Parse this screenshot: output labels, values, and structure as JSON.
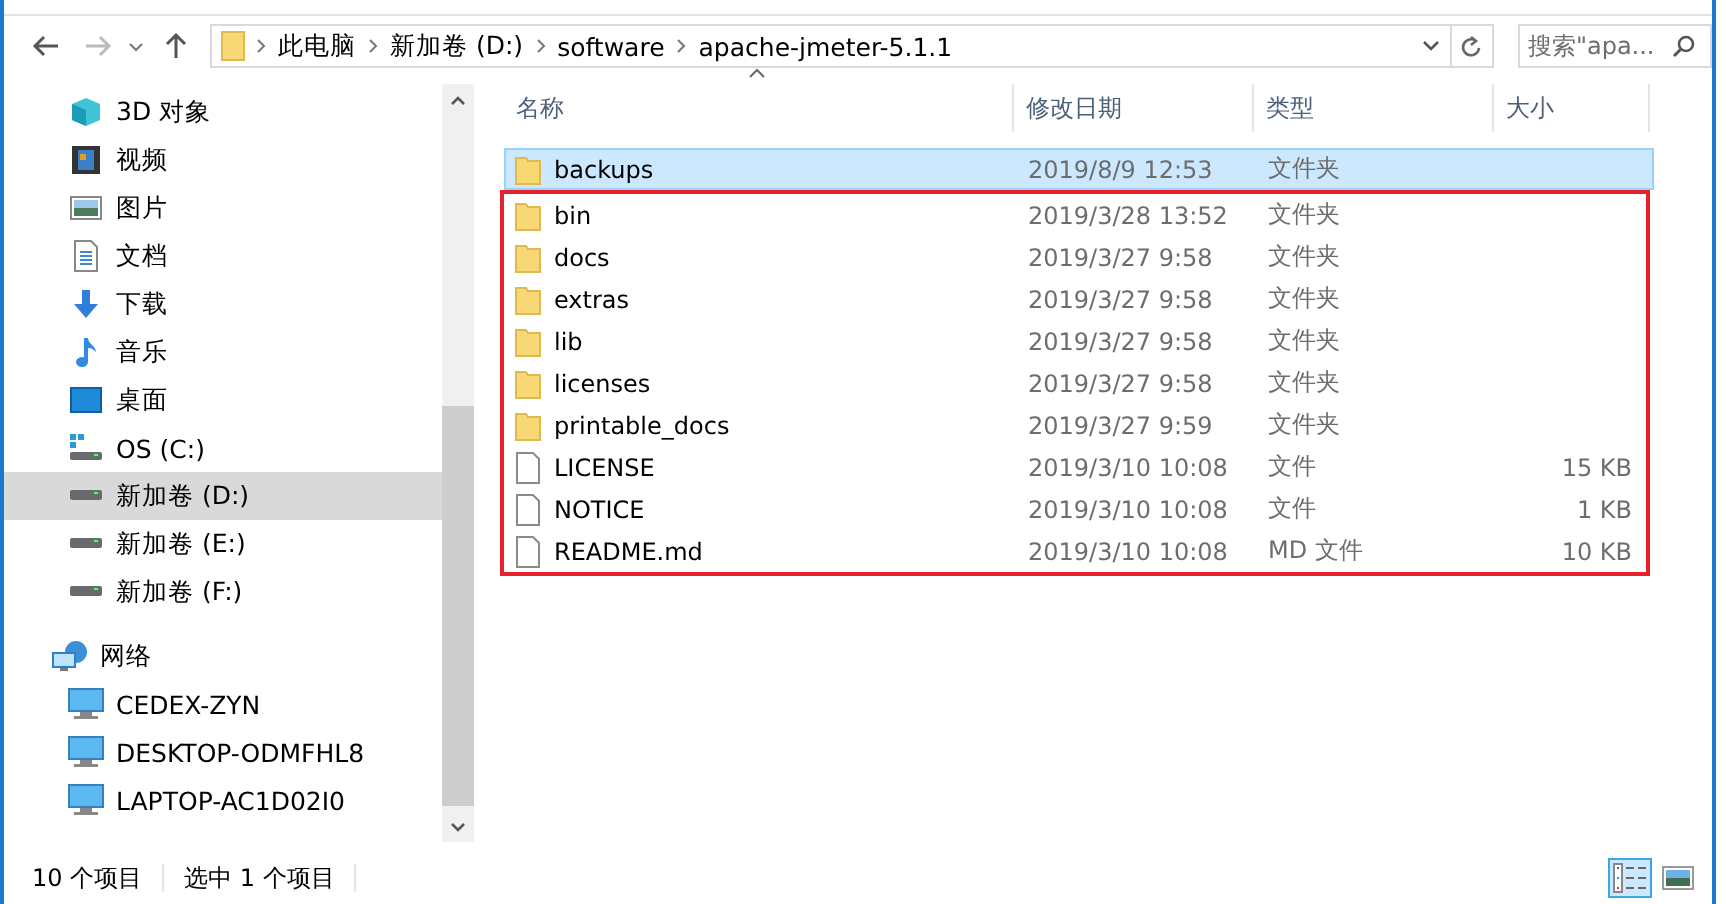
{
  "address_bar": {
    "segments": [
      "此电脑",
      "新加卷 (D:)",
      "software",
      "apache-jmeter-5.1.1"
    ]
  },
  "search": {
    "placeholder": "搜索\"apa..."
  },
  "sidebar": {
    "items": [
      {
        "label": "3D 对象",
        "kind": "objects",
        "selected": false
      },
      {
        "label": "视频",
        "kind": "video",
        "selected": false
      },
      {
        "label": "图片",
        "kind": "pictures",
        "selected": false
      },
      {
        "label": "文档",
        "kind": "documents",
        "selected": false
      },
      {
        "label": "下载",
        "kind": "download",
        "selected": false
      },
      {
        "label": "音乐",
        "kind": "music",
        "selected": false
      },
      {
        "label": "桌面",
        "kind": "desktop",
        "selected": false
      },
      {
        "label": "OS (C:)",
        "kind": "systemdrive",
        "selected": false
      },
      {
        "label": "新加卷 (D:)",
        "kind": "drive",
        "selected": true
      },
      {
        "label": "新加卷 (E:)",
        "kind": "drive",
        "selected": false
      },
      {
        "label": "新加卷 (F:)",
        "kind": "drive",
        "selected": false
      },
      {
        "label": "网络",
        "kind": "network",
        "selected": false,
        "children": [
          {
            "label": "CEDEX-ZYN",
            "kind": "computer",
            "selected": false
          },
          {
            "label": "DESKTOP-ODMFHL8",
            "kind": "computer",
            "selected": false
          },
          {
            "label": "LAPTOP-AC1D02I0",
            "kind": "computer",
            "selected": false
          }
        ]
      }
    ]
  },
  "table": {
    "columns": [
      "名称",
      "修改日期",
      "类型",
      "大小"
    ],
    "rows": [
      {
        "name": "backups",
        "kind": "folder",
        "date": "2019/8/9 12:53",
        "type": "文件夹",
        "selected": true,
        "highlighted": false
      },
      {
        "name": "bin",
        "kind": "folder",
        "date": "2019/3/28 13:52",
        "type": "文件夹",
        "selected": false,
        "highlighted": true
      },
      {
        "name": "docs",
        "kind": "folder",
        "date": "2019/3/27 9:58",
        "type": "文件夹",
        "selected": false,
        "highlighted": true
      },
      {
        "name": "extras",
        "kind": "folder",
        "date": "2019/3/27 9:58",
        "type": "文件夹",
        "selected": false,
        "highlighted": true
      },
      {
        "name": "lib",
        "kind": "folder",
        "date": "2019/3/27 9:58",
        "type": "文件夹",
        "selected": false,
        "highlighted": true
      },
      {
        "name": "licenses",
        "kind": "folder",
        "date": "2019/3/27 9:58",
        "type": "文件夹",
        "selected": false,
        "highlighted": true
      },
      {
        "name": "printable_docs",
        "kind": "folder",
        "date": "2019/3/27 9:59",
        "type": "文件夹",
        "selected": false,
        "highlighted": true
      },
      {
        "name": "LICENSE",
        "kind": "file",
        "date": "2019/3/10 10:08",
        "type": "文件",
        "size": "15 KB",
        "selected": false,
        "highlighted": true
      },
      {
        "name": "NOTICE",
        "kind": "file",
        "date": "2019/3/10 10:08",
        "type": "文件",
        "size": "1 KB",
        "selected": false,
        "highlighted": true
      },
      {
        "name": "README.md",
        "kind": "file",
        "date": "2019/3/10 10:08",
        "type": "MD 文件",
        "size": "10 KB",
        "selected": false,
        "highlighted": true
      }
    ]
  },
  "status_bar": {
    "item_count": "10 个项目",
    "selection": "选中 1 个项目"
  },
  "view_buttons": [
    {
      "kind": "details",
      "selected": true
    },
    {
      "kind": "thumbnails",
      "selected": false
    }
  ]
}
